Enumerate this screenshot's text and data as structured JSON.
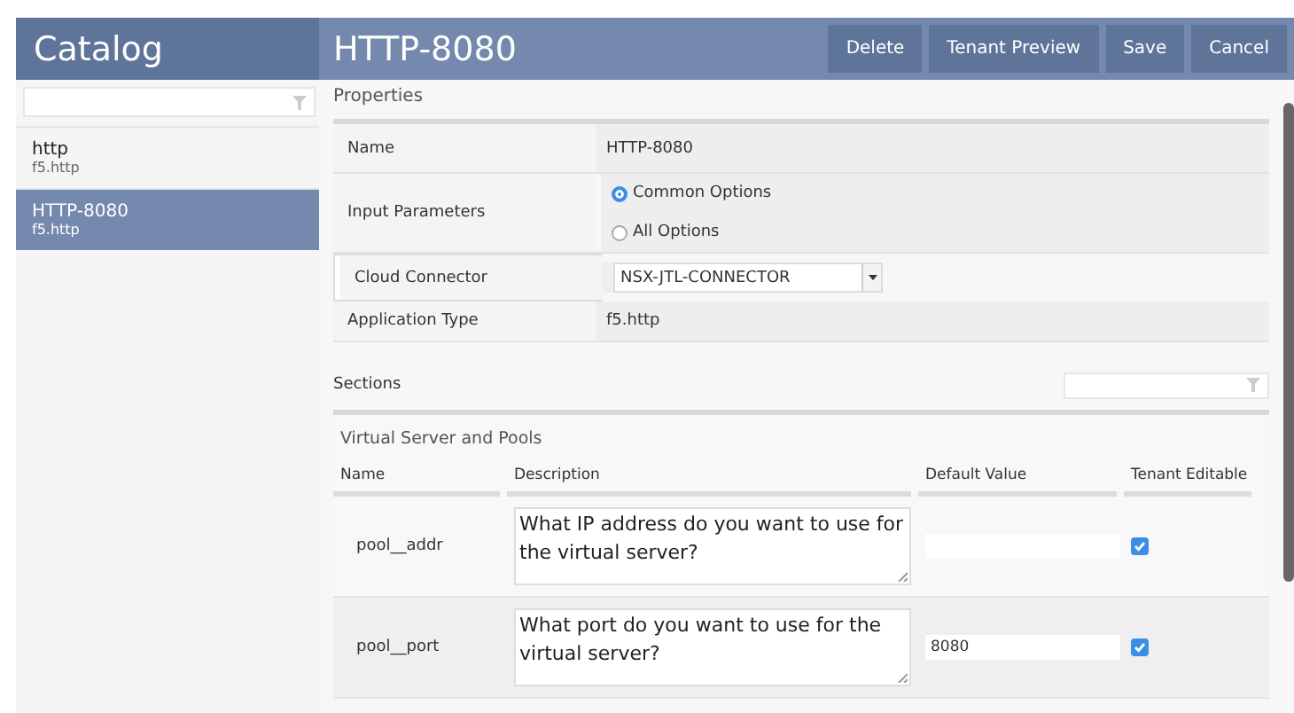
{
  "catalog": {
    "title": "Catalog",
    "items": [
      {
        "name": "http",
        "type": "f5.http",
        "selected": false
      },
      {
        "name": "HTTP-8080",
        "type": "f5.http",
        "selected": true
      }
    ]
  },
  "header": {
    "title": "HTTP-8080",
    "buttons": [
      "Delete",
      "Tenant Preview",
      "Save",
      "Cancel"
    ]
  },
  "properties": {
    "title": "Properties",
    "rows": [
      {
        "kind": "text",
        "label": "Name",
        "value": "HTTP-8080"
      },
      {
        "kind": "radio",
        "label": "Input Parameters",
        "options": [
          {
            "label": "Common Options",
            "selected": true
          },
          {
            "label": "All Options",
            "selected": false
          }
        ]
      },
      {
        "kind": "select",
        "label": "Cloud Connector",
        "value": "NSX-JTL-CONNECTOR"
      },
      {
        "kind": "text",
        "label": "Application Type",
        "value": "f5.http"
      }
    ]
  },
  "sections": {
    "title": "Sections",
    "group": {
      "title": "Virtual Server and Pools",
      "columns": [
        "Name",
        "Description",
        "Default Value",
        "Tenant Editable"
      ],
      "rows": [
        {
          "name": "pool__addr",
          "description": "What IP address do you want to use for the virtual server?",
          "default_value": "",
          "tenant_editable": true
        },
        {
          "name": "pool__port",
          "description": "What port do you want to use for the virtual server?",
          "default_value": "8080",
          "tenant_editable": true
        }
      ]
    }
  }
}
